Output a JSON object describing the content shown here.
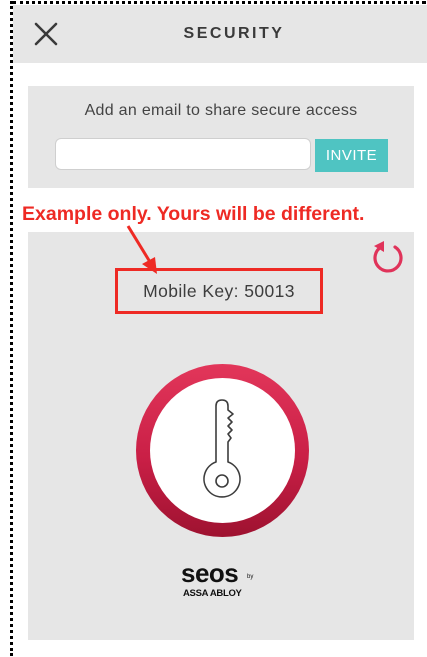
{
  "header": {
    "title": "SECURITY",
    "close_icon": "close-icon"
  },
  "invite": {
    "prompt": "Add an email to share secure access",
    "email_value": "",
    "email_placeholder": "",
    "button_label": "INVITE"
  },
  "annotation": {
    "note": "Example only. Yours will be different.",
    "color": "#ee2a24"
  },
  "mobile_key": {
    "label": "Mobile Key: 50013"
  },
  "icons": {
    "refresh": "refresh-icon",
    "key": "key-icon"
  },
  "brand": {
    "logo_text": "seos",
    "by_text": "by",
    "company": "ASSA ABLOY"
  },
  "colors": {
    "accent_teal": "#4fc4c2",
    "key_ring": "#d02a4f",
    "refresh": "#e0335a",
    "panel_bg": "#e6e6e6"
  }
}
